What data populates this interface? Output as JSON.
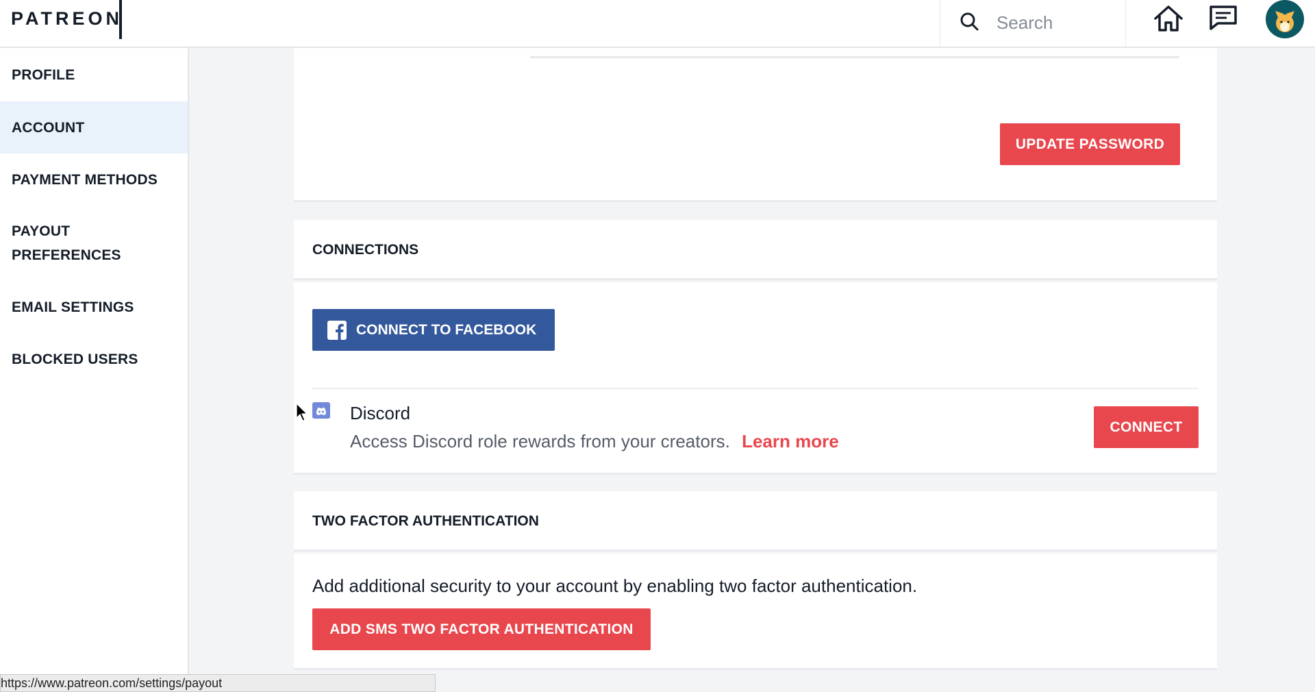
{
  "header": {
    "logo": "PATREON",
    "search_placeholder": "Search"
  },
  "sidebar": {
    "items": [
      {
        "label": "PROFILE"
      },
      {
        "label": "ACCOUNT"
      },
      {
        "label": "PAYMENT METHODS"
      },
      {
        "label": "PAYOUT PREFERENCES"
      },
      {
        "label": "EMAIL SETTINGS"
      },
      {
        "label": "BLOCKED USERS"
      }
    ],
    "active": "ACCOUNT"
  },
  "password": {
    "update_button": "UPDATE PASSWORD"
  },
  "connections": {
    "title": "CONNECTIONS",
    "facebook_button": "CONNECT TO FACEBOOK",
    "discord": {
      "name": "Discord",
      "description": "Access Discord role rewards from your creators.",
      "learn_more": "Learn more",
      "connect_button": "CONNECT"
    }
  },
  "two_factor": {
    "title": "TWO FACTOR AUTHENTICATION",
    "description": "Add additional security to your account by enabling two factor authentication.",
    "add_button": "ADD SMS TWO FACTOR AUTHENTICATION"
  },
  "status_bar": {
    "url": "https://www.patreon.com/settings/payout"
  },
  "colors": {
    "brand_red": "#e8474d",
    "facebook_blue": "#34589c",
    "discord_blurple": "#7289da",
    "active_nav": "#e9f1fb"
  }
}
